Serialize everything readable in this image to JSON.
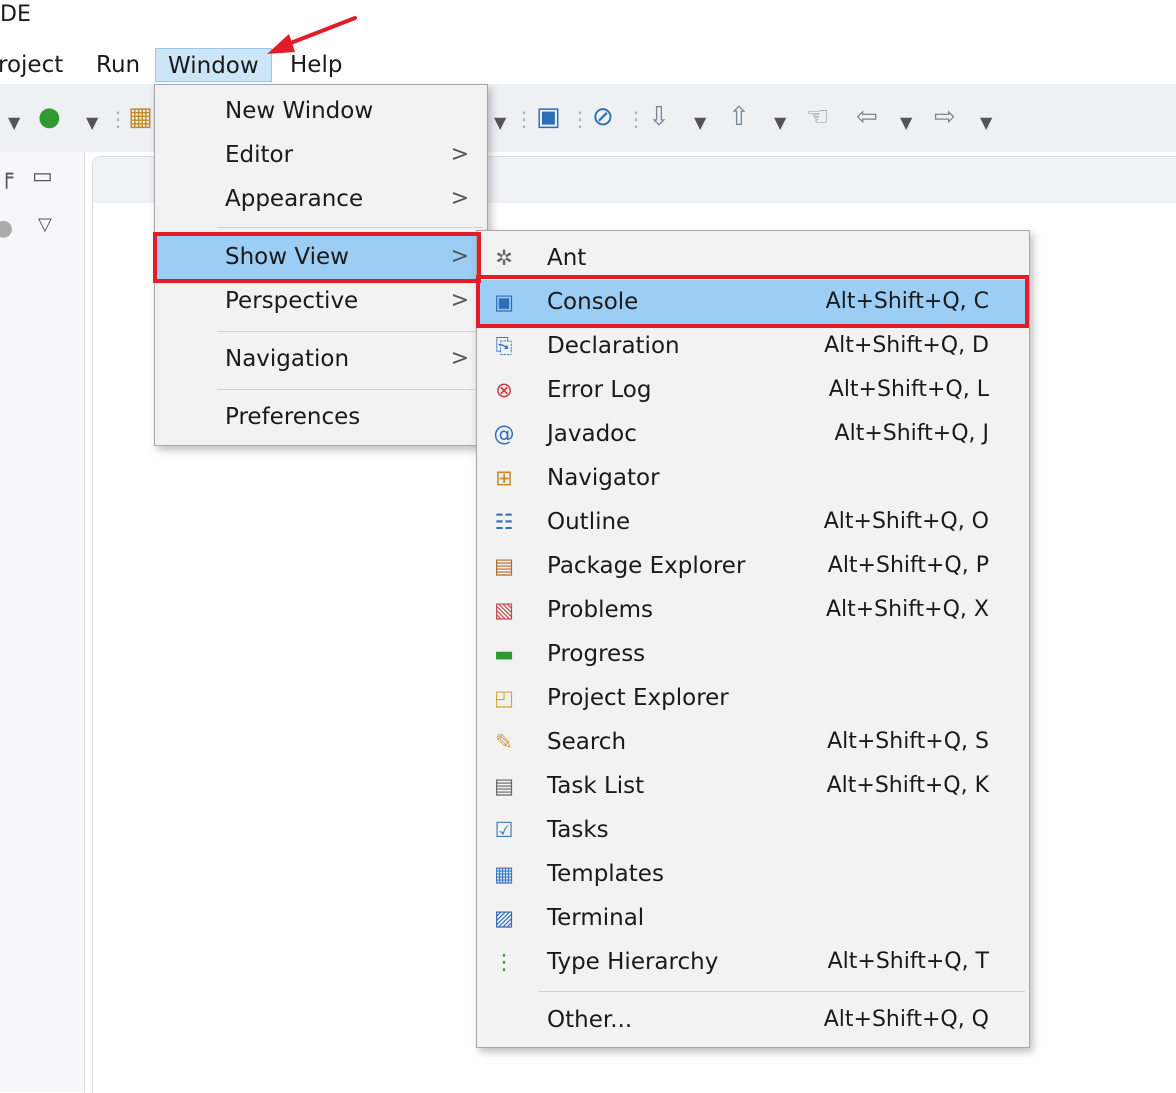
{
  "window": {
    "title_fragment": "DE"
  },
  "menubar": {
    "items": [
      {
        "label": "roject"
      },
      {
        "label": "Run"
      },
      {
        "label": "Window"
      },
      {
        "label": "Help"
      }
    ]
  },
  "window_menu": {
    "items": [
      {
        "label": "New Window"
      },
      {
        "label": "Editor",
        "arrow": ">"
      },
      {
        "label": "Appearance",
        "arrow": ">"
      },
      {
        "label": "Show View",
        "arrow": ">"
      },
      {
        "label": "Perspective",
        "arrow": ">"
      },
      {
        "label": "Navigation",
        "arrow": ">"
      },
      {
        "label": "Preferences"
      }
    ]
  },
  "show_view_menu": {
    "items": [
      {
        "label": "Ant",
        "shortcut": "",
        "icon": "ant-icon"
      },
      {
        "label": "Console",
        "shortcut": "Alt+Shift+Q, C",
        "icon": "console-icon"
      },
      {
        "label": "Declaration",
        "shortcut": "Alt+Shift+Q, D",
        "icon": "declaration-icon"
      },
      {
        "label": "Error Log",
        "shortcut": "Alt+Shift+Q, L",
        "icon": "error-log-icon"
      },
      {
        "label": "Javadoc",
        "shortcut": "Alt+Shift+Q, J",
        "icon": "javadoc-icon"
      },
      {
        "label": "Navigator",
        "shortcut": "",
        "icon": "navigator-icon"
      },
      {
        "label": "Outline",
        "shortcut": "Alt+Shift+Q, O",
        "icon": "outline-icon"
      },
      {
        "label": "Package Explorer",
        "shortcut": "Alt+Shift+Q, P",
        "icon": "package-explorer-icon"
      },
      {
        "label": "Problems",
        "shortcut": "Alt+Shift+Q, X",
        "icon": "problems-icon"
      },
      {
        "label": "Progress",
        "shortcut": "",
        "icon": "progress-icon"
      },
      {
        "label": "Project Explorer",
        "shortcut": "",
        "icon": "project-explorer-icon"
      },
      {
        "label": "Search",
        "shortcut": "Alt+Shift+Q, S",
        "icon": "search-icon"
      },
      {
        "label": "Task List",
        "shortcut": "Alt+Shift+Q, K",
        "icon": "task-list-icon"
      },
      {
        "label": "Tasks",
        "shortcut": "",
        "icon": "tasks-icon"
      },
      {
        "label": "Templates",
        "shortcut": "",
        "icon": "templates-icon"
      },
      {
        "label": "Terminal",
        "shortcut": "",
        "icon": "terminal-icon"
      },
      {
        "label": "Type Hierarchy",
        "shortcut": "Alt+Shift+Q, T",
        "icon": "type-hierarchy-icon"
      },
      {
        "label": "Other...",
        "shortcut": "Alt+Shift+Q, Q",
        "icon": ""
      }
    ]
  },
  "colors": {
    "highlight": "#9ccdf5",
    "annotation": "#e11d2a"
  }
}
